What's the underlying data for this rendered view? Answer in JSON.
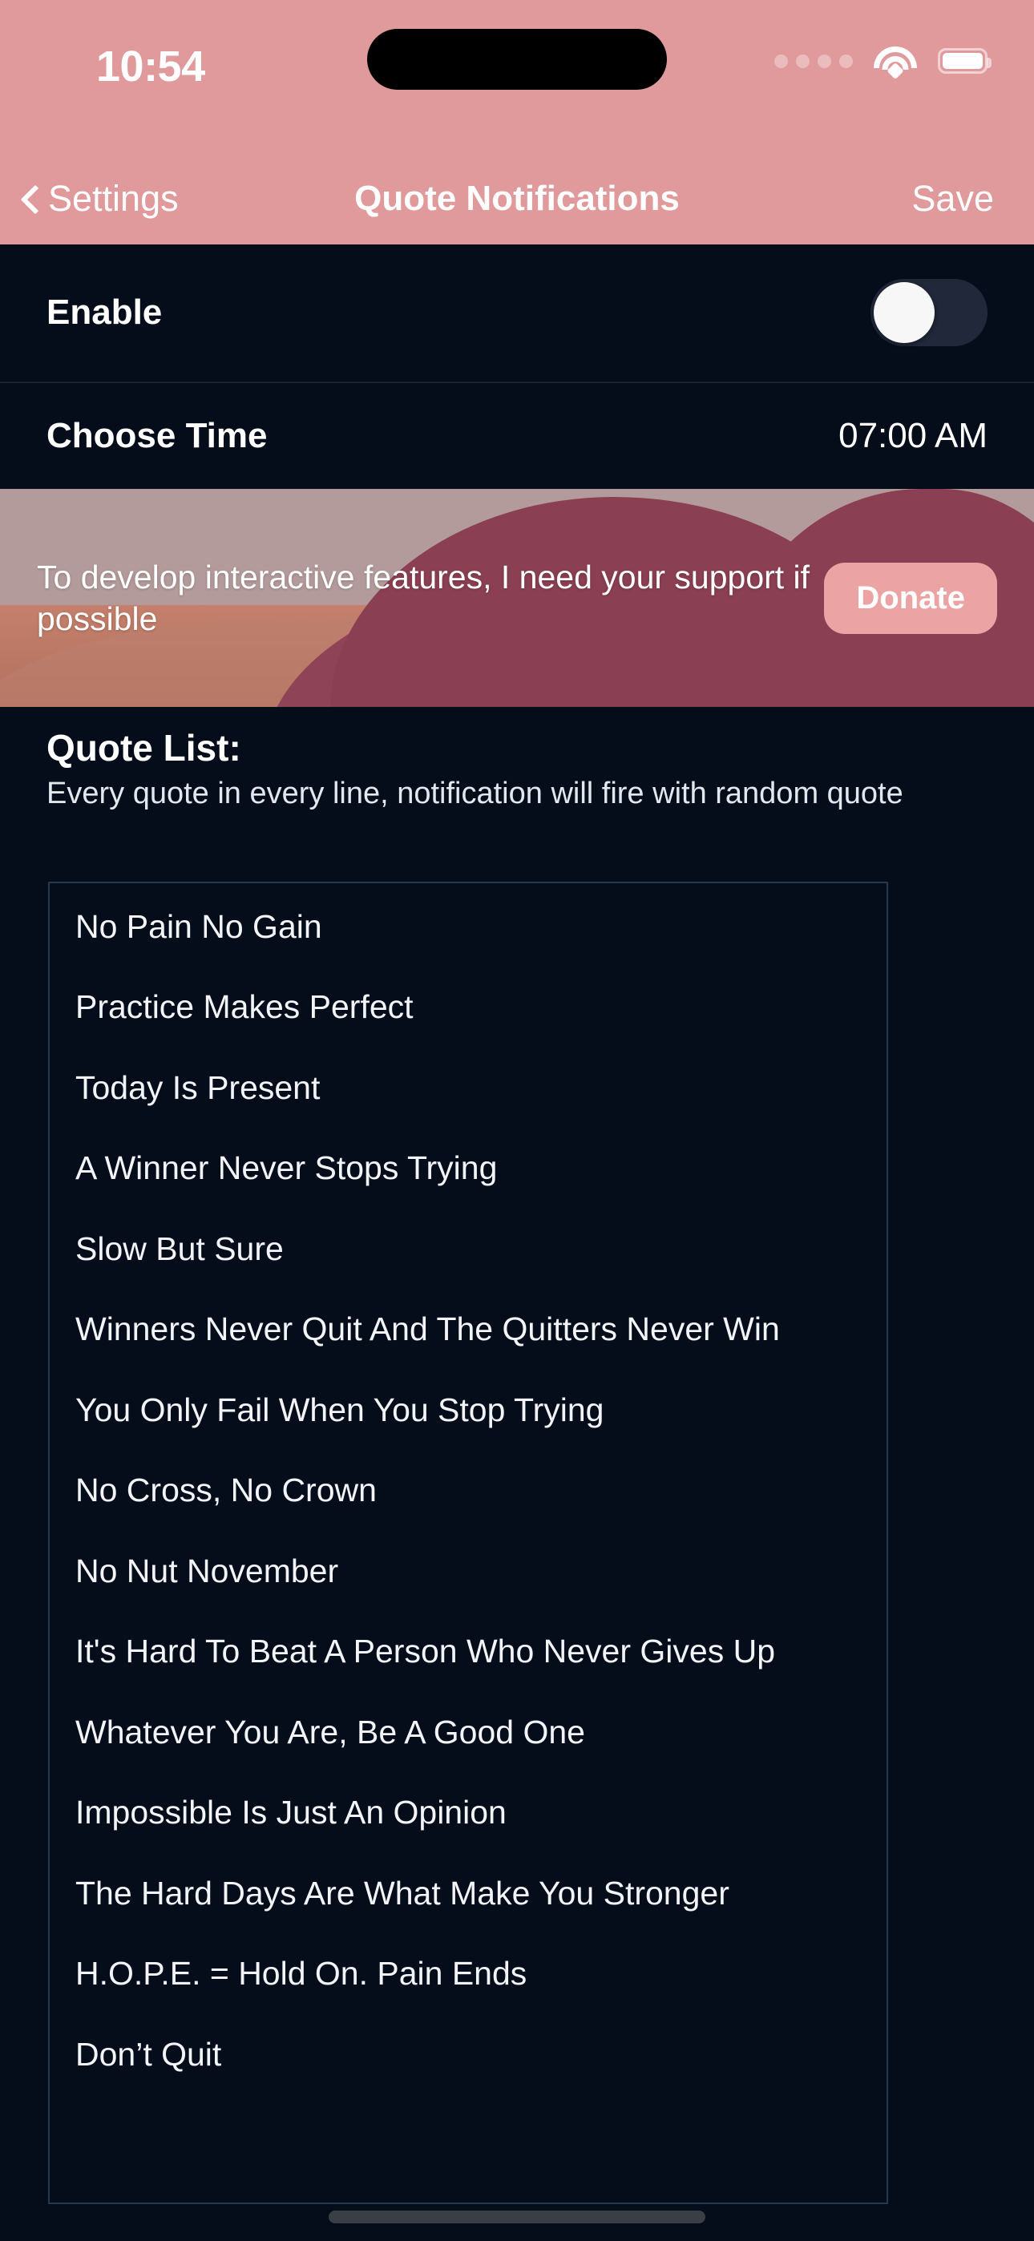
{
  "status_bar": {
    "time": "10:54",
    "cellular_icon": "cellular-dots-icon",
    "wifi_icon": "wifi-icon",
    "battery_icon": "battery-full-icon"
  },
  "nav_bar": {
    "back_icon": "chevron-left-icon",
    "back_label": "Settings",
    "title": "Quote Notifications",
    "save_label": "Save"
  },
  "settings": {
    "enable": {
      "label": "Enable",
      "toggle_state": "off"
    },
    "choose_time": {
      "label": "Choose Time",
      "value": "07:00 AM"
    }
  },
  "donate_banner": {
    "message": "To develop interactive features, I need your support if possible",
    "button_label": "Donate",
    "button_color": "#ECA3A3",
    "mountain_color": "#8B3F52",
    "ground_color": "#C4806C"
  },
  "quote_list": {
    "heading": "Quote List:",
    "subtitle": "Every quote in every line, notification will fire with random quote",
    "quotes": [
      "No Pain No Gain",
      "Practice Makes Perfect",
      "Today Is Present",
      "A Winner Never Stops Trying",
      "Slow But Sure",
      "Winners Never Quit And The Quitters Never Win",
      "You Only Fail When You Stop Trying",
      "No Cross, No Crown",
      "No Nut November",
      "It's Hard To Beat A Person Who Never Gives Up",
      "Whatever You Are, Be A Good One",
      "Impossible Is Just An Opinion",
      "The Hard Days Are What Make You Stronger",
      "H.O.P.E. = Hold On. Pain Ends",
      "Don’t Quit"
    ]
  },
  "theme": {
    "accent": "#E09A9B",
    "background": "#050D1B",
    "text": "#FFFFFF"
  }
}
